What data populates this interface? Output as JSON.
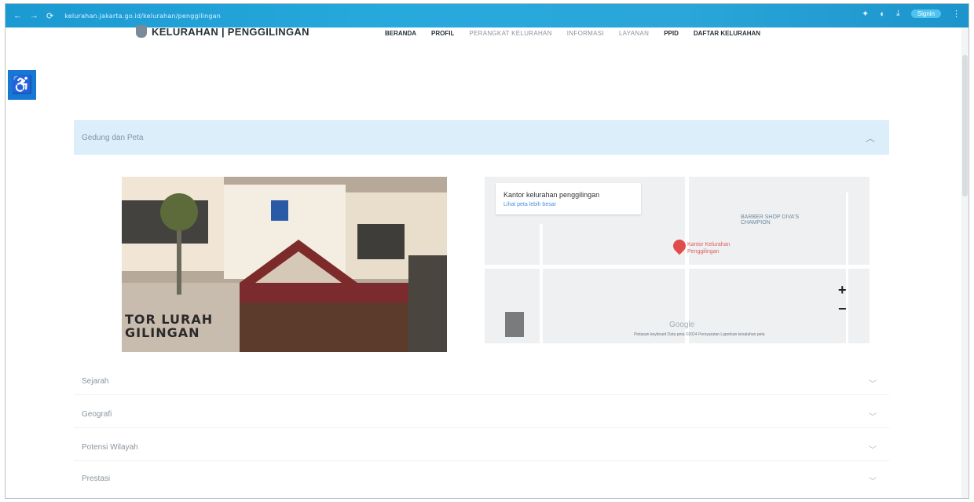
{
  "browser": {
    "url": "kelurahan.jakarta.go.id/kelurahan/penggilingan",
    "profile_label": "Signin"
  },
  "site": {
    "logo_text": "KELURAHAN | PENGGILINGAN"
  },
  "nav": {
    "items": [
      "BERANDA",
      "PROFIL",
      "PERANGKAT KELURAHAN",
      "INFORMASI",
      "LAYANAN",
      "PPID",
      "DAFTAR KELURAHAN"
    ]
  },
  "accordion": {
    "open_title": "Gedung dan Peta",
    "sections": [
      "Sejarah",
      "Geografi",
      "Potensi Wilayah",
      "Prestasi"
    ]
  },
  "photo": {
    "sign_line1": "TOR LURAH",
    "sign_line2": "GILINGAN"
  },
  "map": {
    "place_name": "Kantor kelurahan penggilingan",
    "view_larger": "Lihat peta lebih besar",
    "poi_barber": "BARBER SHOP DIVA'S CHAMPION",
    "poi_pin_label": "Kantor Kelurahan Penggilingan",
    "zoom_in": "+",
    "zoom_out": "−",
    "footer": "Pintasan keyboard   Data peta ©2024   Persyaratan   Laporkan kesalahan peta"
  },
  "icons": {
    "accessibility": "wheelchair-icon",
    "chevron_up": "chevron-up-icon",
    "chevron_down": "chevron-down-icon"
  },
  "colors": {
    "browser_bar": "#1b9ad1",
    "accent_blue": "#1778d4",
    "accordion_bg": "#dceefa",
    "map_pin": "#e04c4c"
  }
}
